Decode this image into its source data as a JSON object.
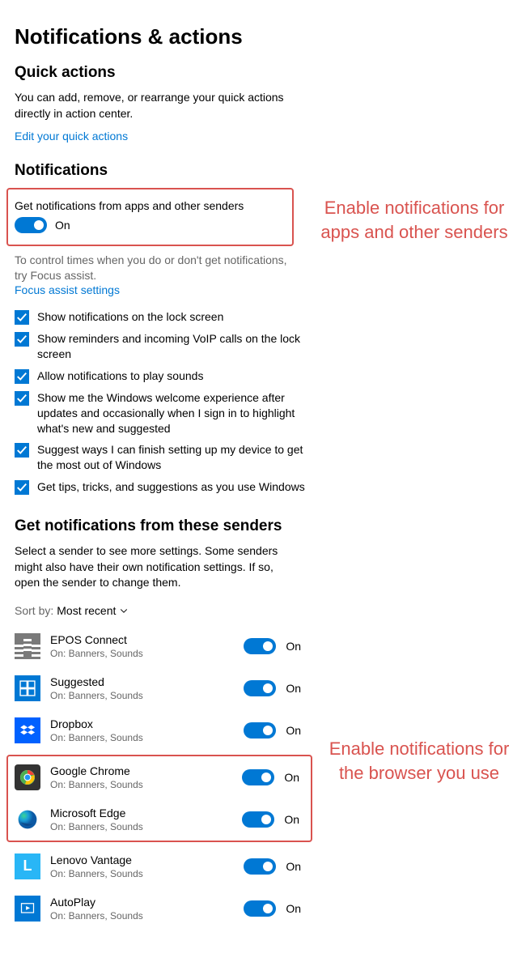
{
  "title": "Notifications & actions",
  "quick": {
    "heading": "Quick actions",
    "desc": "You can add, remove, or rearrange your quick actions directly in action center.",
    "edit_link": "Edit your quick actions"
  },
  "notif": {
    "heading": "Notifications",
    "master_label": "Get notifications from apps and other senders",
    "master_state": "On",
    "assist_desc": "To control times when you do or don't get notifications, try Focus assist.",
    "assist_link": "Focus assist settings"
  },
  "checks": [
    "Show notifications on the lock screen",
    "Show reminders and incoming VoIP calls on the lock screen",
    "Allow notifications to play sounds",
    "Show me the Windows welcome experience after updates and occasionally when I sign in to highlight what's new and suggested",
    "Suggest ways I can finish setting up my device to get the most out of Windows",
    "Get tips, tricks, and suggestions as you use Windows"
  ],
  "senders": {
    "heading": "Get notifications from these senders",
    "desc": "Select a sender to see more settings. Some senders might also have their own notification settings. If so, open the sender to change them.",
    "sort_label": "Sort by:",
    "sort_value": "Most recent",
    "sub": "On: Banners, Sounds",
    "state": "On",
    "items": [
      {
        "name": "EPOS Connect",
        "icon": "epos"
      },
      {
        "name": "Suggested",
        "icon": "suggested"
      },
      {
        "name": "Dropbox",
        "icon": "dropbox"
      },
      {
        "name": "Google Chrome",
        "icon": "chrome"
      },
      {
        "name": "Microsoft Edge",
        "icon": "edge"
      },
      {
        "name": "Lenovo Vantage",
        "icon": "lenovo"
      },
      {
        "name": "AutoPlay",
        "icon": "autoplay"
      }
    ]
  },
  "annotations": {
    "a1": "Enable notifications for apps and other senders",
    "a2": "Enable notifications for the browser you use"
  }
}
